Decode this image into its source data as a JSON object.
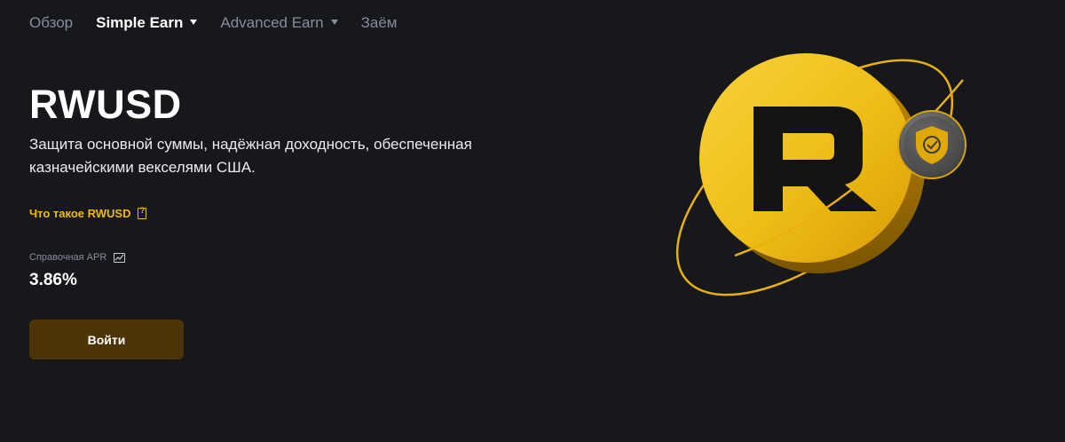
{
  "nav": {
    "items": [
      {
        "label": "Обзор",
        "active": false,
        "dropdown": false
      },
      {
        "label": "Simple Earn",
        "active": true,
        "dropdown": true
      },
      {
        "label": "Advanced Earn",
        "active": false,
        "dropdown": true
      },
      {
        "label": "Заём",
        "active": false,
        "dropdown": false
      }
    ]
  },
  "hero": {
    "title": "RWUSD",
    "subtitle": "Защита основной суммы, надёжная доходность, обеспеченная казначейскими векселями США.",
    "learn_link": "Что такое RWUSD",
    "apr_label": "Справочная APR",
    "apr_value": "3.86%",
    "login_button": "Войти"
  },
  "colors": {
    "background": "#17181c",
    "accent": "#f0b90b",
    "button_bg": "#4b3507",
    "muted": "#848e9c"
  },
  "icons": [
    "caret-down-icon",
    "doc-question-icon",
    "line-chart-icon",
    "coin-illustration",
    "shield-check-icon"
  ]
}
